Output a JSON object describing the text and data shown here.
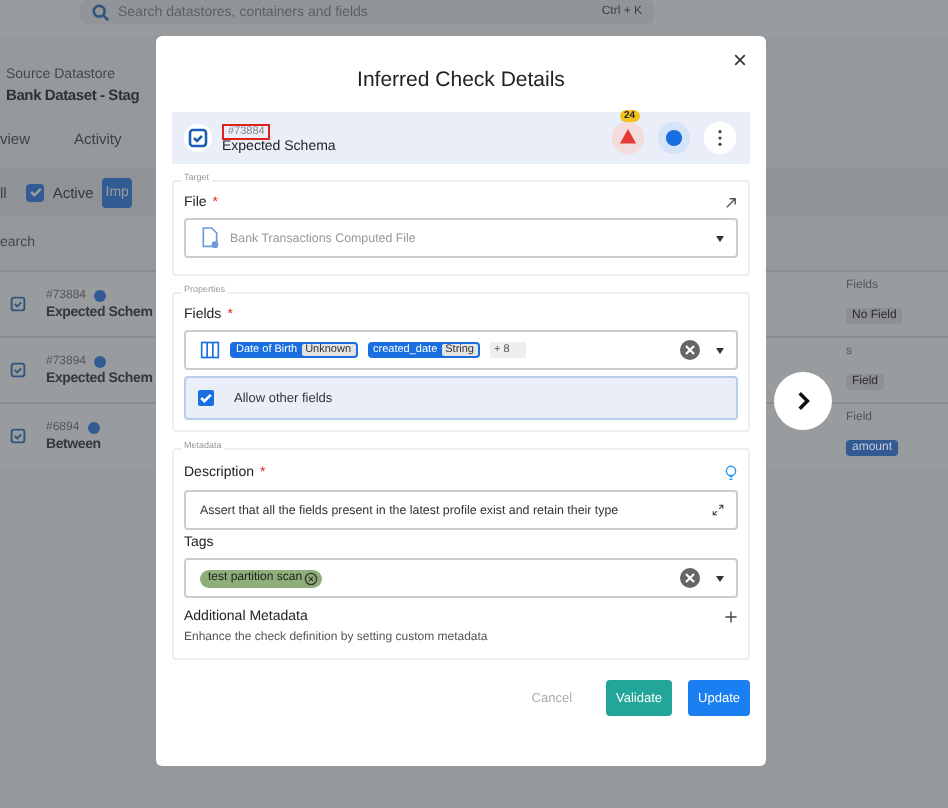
{
  "background": {
    "search_placeholder": "Search datastores, containers and fields",
    "shortcut": "Ctrl + K",
    "datastore_label": "Source Datastore",
    "datastore_name": "Bank Dataset - Stag",
    "tabs": [
      "view",
      "Activity"
    ],
    "filter": {
      "all": "ll",
      "active_label": "Active",
      "active_checked": true,
      "button": "Imp"
    },
    "search": "earch",
    "checks": [
      {
        "id": "#73884",
        "name": "Expected Schem",
        "checked": true,
        "field_label": "Fields",
        "field_tag": "No Field",
        "color": "#8d8f92"
      },
      {
        "id": "#73894",
        "name": "Expected Schem",
        "checked": true,
        "field_label": "s",
        "field_tag": "Field",
        "color": "#8d8f92"
      },
      {
        "id": "#6894",
        "name": "Between",
        "checked": true,
        "field_label": "Field",
        "field_tag": "amount",
        "color": "#325b91"
      }
    ]
  },
  "modal": {
    "title": "Inferred Check Details",
    "check": {
      "id": "#73884",
      "id_highlighted": true,
      "name": "Expected Schema",
      "alert_count": "24"
    },
    "target": {
      "section": "Target",
      "label": "File",
      "required_mark": "*",
      "value": "Bank Transactions Computed File"
    },
    "properties": {
      "section": "Properties",
      "label": "Fields",
      "required_mark": "*",
      "chips": [
        {
          "name": "Date of Birth",
          "type": "Unknown"
        },
        {
          "name": "created_date",
          "type": "String"
        }
      ],
      "more": "+ 8",
      "allow_other": {
        "label": "Allow other fields",
        "checked": true
      }
    },
    "metadata": {
      "section": "Metadata",
      "description_label": "Description",
      "description_required_mark": "*",
      "description": "Assert that all the fields present in the latest profile exist and retain their type",
      "tags_label": "Tags",
      "tags": [
        {
          "label": "test partition scan",
          "color": "#8fae7a"
        }
      ],
      "additional_title": "Additional Metadata",
      "additional_text": "Enhance the check definition by setting custom metadata"
    },
    "buttons": [
      {
        "label": "Cancel",
        "kind": "text"
      },
      {
        "label": "Validate",
        "kind": "validate"
      },
      {
        "label": "Update",
        "kind": "primary"
      }
    ]
  }
}
